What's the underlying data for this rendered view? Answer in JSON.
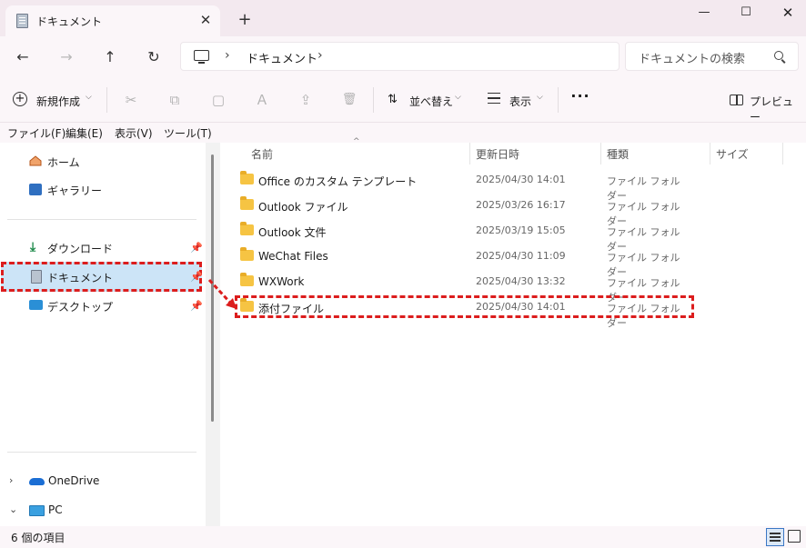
{
  "window": {
    "tab_title": "ドキュメント",
    "tab_close": "✕",
    "new_tab": "+",
    "minimize": "—",
    "maximize": "☐",
    "close": "✕"
  },
  "nav": {
    "back": "←",
    "forward": "→",
    "up": "↑",
    "refresh": "↻",
    "address_sep": "›",
    "address_path": "ドキュメント",
    "search_placeholder": "ドキュメントの検索"
  },
  "toolbar": {
    "new_label": "新規作成",
    "sort_label": "並べ替え",
    "view_label": "表示",
    "more_label": "···",
    "preview_label": "プレビュー",
    "cut_icon": "✂",
    "copy_icon": "⧉",
    "paste_icon": "▢",
    "rename_icon": "Ａ",
    "share_icon": "⇪",
    "delete_icon": "🗑"
  },
  "menu": [
    "ファイル(F)",
    "編集(E)",
    "表示(V)",
    "ツール(T)"
  ],
  "sidebar": {
    "home": "ホーム",
    "gallery": "ギャラリー",
    "downloads": "ダウンロード",
    "documents": "ドキュメント",
    "desktop": "デスクトップ",
    "onedrive": "OneDrive",
    "pc": "PC"
  },
  "columns": {
    "name": "名前",
    "modified": "更新日時",
    "type": "種類",
    "size": "サイズ"
  },
  "files": [
    {
      "name": "Office のカスタム テンプレート",
      "modified": "2025/04/30 14:01",
      "type": "ファイル フォルダー"
    },
    {
      "name": "Outlook ファイル",
      "modified": "2025/03/26 16:17",
      "type": "ファイル フォルダー"
    },
    {
      "name": "Outlook 文件",
      "modified": "2025/03/19 15:05",
      "type": "ファイル フォルダー"
    },
    {
      "name": "WeChat Files",
      "modified": "2025/04/30 11:09",
      "type": "ファイル フォルダー"
    },
    {
      "name": "WXWork",
      "modified": "2025/04/30 13:32",
      "type": "ファイル フォルダー"
    },
    {
      "name": "添付ファイル",
      "modified": "2025/04/30 14:01",
      "type": "ファイル フォルダー"
    }
  ],
  "status": {
    "item_count": "6 個の項目"
  },
  "colors": {
    "highlight": "#dc1d1d",
    "selection": "#cce4f7",
    "folder": "#f6c443"
  }
}
